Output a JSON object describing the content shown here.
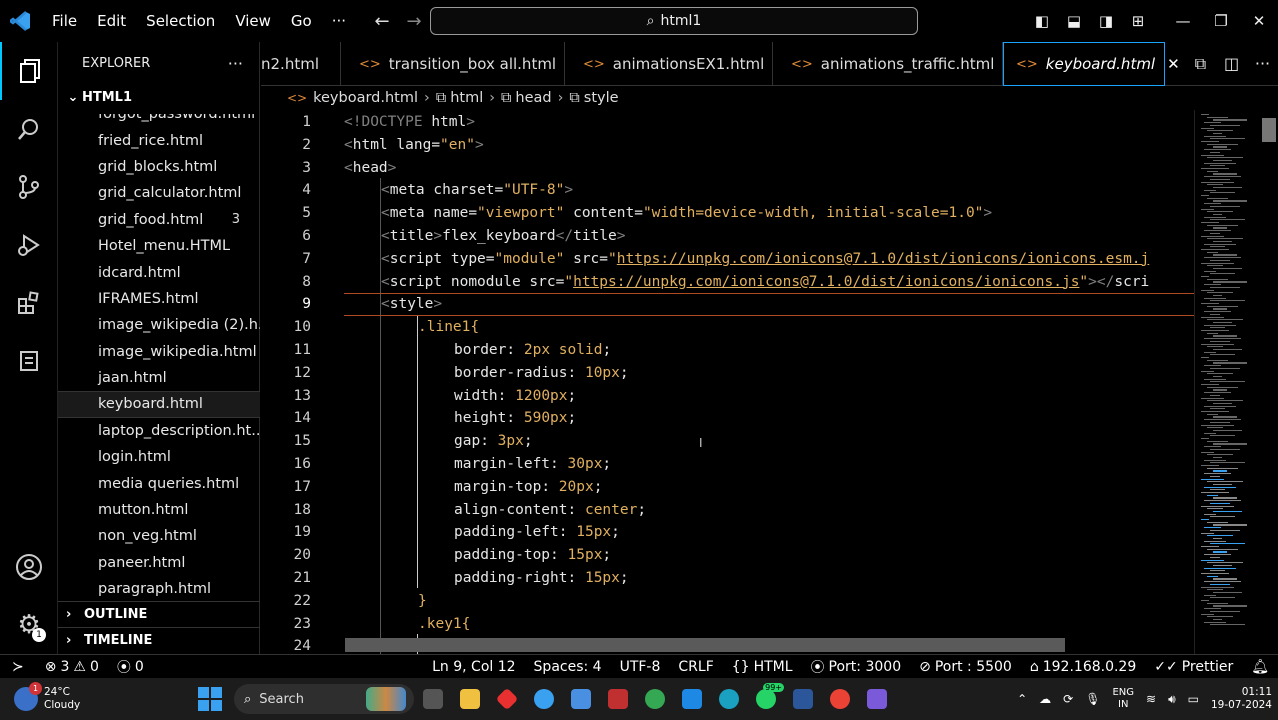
{
  "menu": {
    "items": [
      "File",
      "Edit",
      "Selection",
      "View",
      "Go",
      "···"
    ]
  },
  "command_center": {
    "text": "html1"
  },
  "explorer": {
    "header": "EXPLORER",
    "more": "···",
    "folder": "HTML1",
    "files": [
      {
        "name": "forgot_password.html",
        "count": ""
      },
      {
        "name": "fried_rice.html",
        "count": ""
      },
      {
        "name": "grid_blocks.html",
        "count": ""
      },
      {
        "name": "grid_calculator.html",
        "count": ""
      },
      {
        "name": "grid_food.html",
        "count": "3"
      },
      {
        "name": "Hotel_menu.HTML",
        "count": ""
      },
      {
        "name": "idcard.html",
        "count": ""
      },
      {
        "name": "IFRAMES.html",
        "count": ""
      },
      {
        "name": "image_wikipedia (2).h...",
        "count": ""
      },
      {
        "name": "image_wikipedia.html",
        "count": ""
      },
      {
        "name": "jaan.html",
        "count": ""
      },
      {
        "name": "keyboard.html",
        "count": ""
      },
      {
        "name": "laptop_description.ht...",
        "count": ""
      },
      {
        "name": "login.html",
        "count": ""
      },
      {
        "name": "media queries.html",
        "count": ""
      },
      {
        "name": "mutton.html",
        "count": ""
      },
      {
        "name": "non_veg.html",
        "count": ""
      },
      {
        "name": "paneer.html",
        "count": ""
      },
      {
        "name": "paragraph.html",
        "count": ""
      }
    ],
    "sections": [
      "OUTLINE",
      "TIMELINE"
    ]
  },
  "tabs": [
    {
      "label": "n2.html"
    },
    {
      "label": "transition_box all.html"
    },
    {
      "label": "animationsEX1.html"
    },
    {
      "label": "animations_traffic.html"
    },
    {
      "label": "keyboard.html"
    }
  ],
  "breadcrumb": [
    "keyboard.html",
    "html",
    "head",
    "style"
  ],
  "editor": {
    "line_numbers": [
      "1",
      "2",
      "3",
      "4",
      "5",
      "6",
      "7",
      "8",
      "9",
      "10",
      "11",
      "12",
      "13",
      "14",
      "15",
      "16",
      "17",
      "18",
      "19",
      "20",
      "21",
      "22",
      "23",
      "24"
    ],
    "head_lines": {
      "l1": {
        "a": "<!DOCTYPE ",
        "b": "html",
        "c": ">"
      },
      "l2": {
        "a": "<",
        "b": "html",
        "c": " lang",
        "d": "=",
        "e": "\"en\"",
        "f": ">"
      },
      "l3": {
        "a": "<",
        "b": "head",
        "c": ">"
      },
      "l4": {
        "a": "<",
        "b": "meta",
        "c": " charset",
        "d": "=",
        "e": "\"UTF-8\"",
        "f": ">"
      },
      "l5": {
        "a": "<",
        "b": "meta",
        "c": " name",
        "d": "=",
        "e": "\"viewport\"",
        "f": " content",
        "g": "=",
        "h": "\"width=device-width, initial-scale=1.0\"",
        "i": ">"
      },
      "l6": {
        "a": "<",
        "b": "title",
        "c": ">",
        "d": "flex_keyboard",
        "e": "</",
        "f": "title",
        "g": ">"
      },
      "l7": {
        "a": "<",
        "b": "script",
        "c": " type",
        "d": "=",
        "e": "\"module\"",
        "f": " src",
        "g": "=",
        "h": "\"",
        "i": "https://unpkg.com/ionicons@7.1.0/dist/ionicons/ionicons.esm.j"
      },
      "l8": {
        "a": "<",
        "b": "script",
        "c": " nomodule",
        "d": " src",
        "e": "=",
        "f": "\"",
        "g": "https://unpkg.com/ionicons@7.1.0/dist/ionicons/ionicons.js",
        "h": "\"",
        "i": "></",
        "j": "scri"
      },
      "l9": {
        "a": "<",
        "b": "style",
        "c": ">"
      }
    },
    "css_selector_1": ".line1{",
    "declarations": [
      {
        "prop": "border",
        "val": "2px solid"
      },
      {
        "prop": "border-radius",
        "val": "10px"
      },
      {
        "prop": "width",
        "val": "1200px"
      },
      {
        "prop": "height",
        "val": "590px"
      },
      {
        "prop": "gap",
        "val": "3px"
      },
      {
        "prop": "margin-left",
        "val": "30px"
      },
      {
        "prop": "margin-top",
        "val": "20px"
      },
      {
        "prop": "align-content",
        "val": "center"
      },
      {
        "prop": "padding-left",
        "val": "15px"
      },
      {
        "prop": "padding-top",
        "val": "15px"
      },
      {
        "prop": "padding-right",
        "val": "15px"
      }
    ],
    "close_brace": "}",
    "css_selector_2": ".key1{"
  },
  "statusbar": {
    "problems_errors": "3",
    "problems_warnings": "0",
    "ports": "0",
    "cursor": "Ln 9, Col 12",
    "spaces": "Spaces: 4",
    "encoding": "UTF-8",
    "eol": "CRLF",
    "language": "HTML",
    "port1": "Port: 3000",
    "port2": "Port : 5500",
    "ip": "192.168.0.29",
    "prettier": "Prettier"
  },
  "taskbar": {
    "weather_temp": "24°C",
    "weather_desc": "Cloudy",
    "weather_badge": "1",
    "search": "Search",
    "whatsapp_badge": "99+",
    "lang1": "ENG",
    "lang2": "IN",
    "time": "01:11",
    "date": "19-07-2024"
  }
}
